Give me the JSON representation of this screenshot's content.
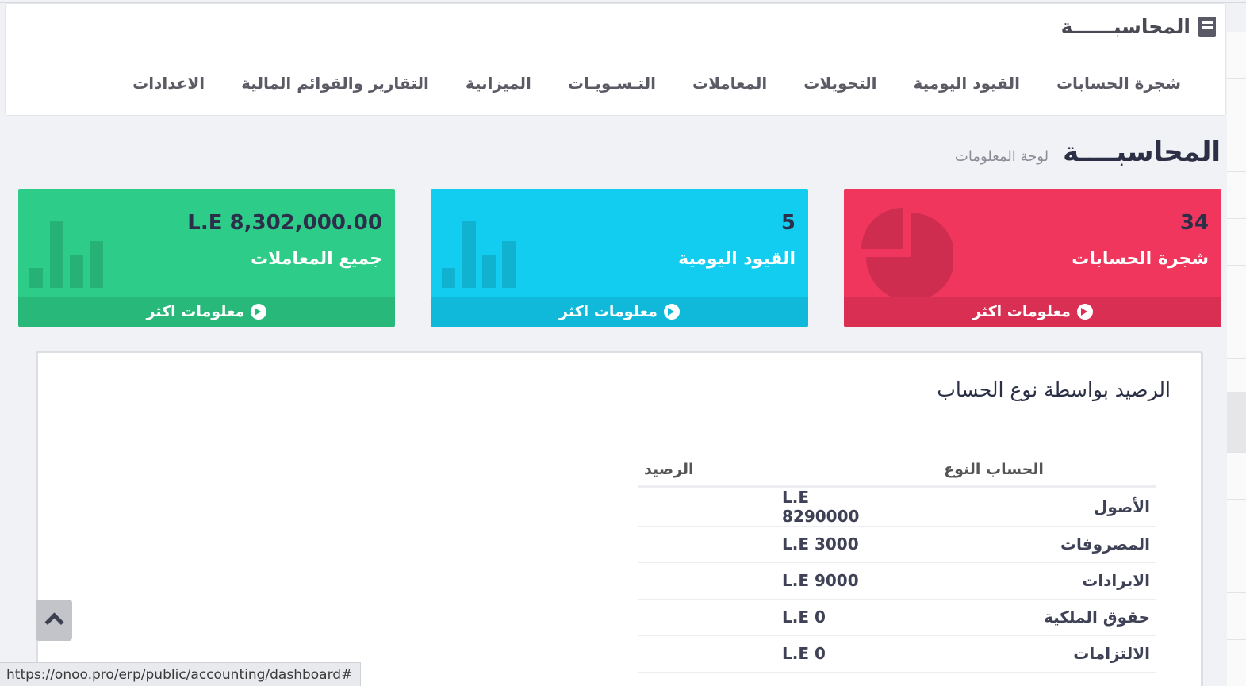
{
  "header": {
    "module_title": "المحاسبــــــة",
    "nav": [
      "شجرة الحسابات",
      "القيود اليومية",
      "التحويلات",
      "المعاملات",
      "التـسـويـات",
      "الميزانية",
      "التقارير والقوائم المالية",
      "الاعدادات"
    ]
  },
  "page": {
    "title": "المحاسبــــة",
    "subtitle": "لوحة المعلومات"
  },
  "cards": {
    "accounts": {
      "value": "34",
      "label": "شجرة الحسابات",
      "more": "معلومات اكثر",
      "color": "#f0365d"
    },
    "journal": {
      "value": "5",
      "label": "القيود اليومية",
      "more": "معلومات اكثر",
      "color": "#13cdf0"
    },
    "transactions": {
      "value": "L.E 8,302,000.00",
      "label": "جميع المعاملات",
      "more": "معلومات اكثر",
      "color": "#2ecc89"
    }
  },
  "balance": {
    "title": "الرصيد بواسطة نوع الحساب",
    "headers": [
      "الحساب النوع",
      "الرصيد"
    ],
    "rows": [
      {
        "type": "الأصول",
        "amount": "L.E 8290000"
      },
      {
        "type": "المصروفات",
        "amount": "L.E 3000"
      },
      {
        "type": "الايرادات",
        "amount": "L.E 9000"
      },
      {
        "type": "حقوق الملكية",
        "amount": "L.E 0"
      },
      {
        "type": "الالتزامات",
        "amount": "L.E 0"
      }
    ]
  },
  "status_url": "https://onoo.pro/erp/public/accounting/dashboard#"
}
